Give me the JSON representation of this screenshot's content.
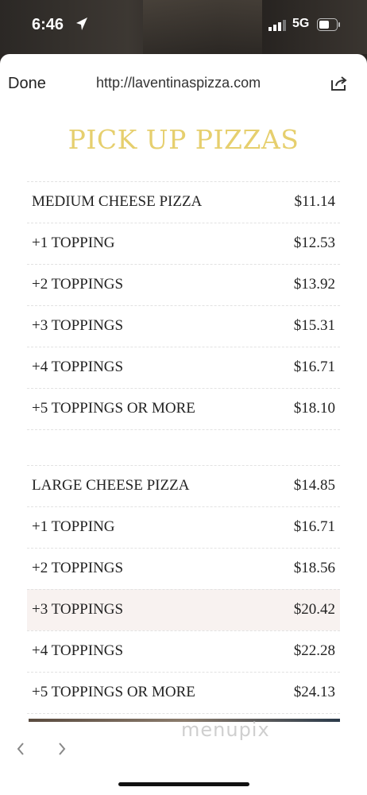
{
  "status_bar": {
    "time": "6:46",
    "network": "5G",
    "icons": [
      "location-arrow-icon",
      "signal-icon",
      "battery-icon"
    ]
  },
  "browser": {
    "done_label": "Done",
    "url": "http://laventinaspizza.com",
    "share_icon": "share-icon",
    "back_icon": "chevron-left-icon",
    "forward_icon": "chevron-right-icon"
  },
  "page": {
    "heading": "PICK UP PIZZAS",
    "heading_color": "#e6cf6e",
    "groups": [
      {
        "items": [
          {
            "name": "MEDIUM CHEESE PIZZA",
            "price": "$11.14"
          },
          {
            "name": "+1 TOPPING",
            "price": "$12.53"
          },
          {
            "name": "+2 TOPPINGS",
            "price": "$13.92"
          },
          {
            "name": "+3 TOPPINGS",
            "price": "$15.31"
          },
          {
            "name": "+4 TOPPINGS",
            "price": "$16.71"
          },
          {
            "name": "+5 TOPPINGS OR MORE",
            "price": "$18.10"
          }
        ]
      },
      {
        "items": [
          {
            "name": "LARGE CHEESE PIZZA",
            "price": "$14.85"
          },
          {
            "name": "+1 TOPPING",
            "price": "$16.71"
          },
          {
            "name": "+2 TOPPINGS",
            "price": "$18.56"
          },
          {
            "name": "+3 TOPPINGS",
            "price": "$20.42"
          },
          {
            "name": "+4 TOPPINGS",
            "price": "$22.28"
          },
          {
            "name": "+5 TOPPINGS OR MORE",
            "price": "$24.13"
          }
        ]
      }
    ]
  },
  "watermark": "menupix"
}
